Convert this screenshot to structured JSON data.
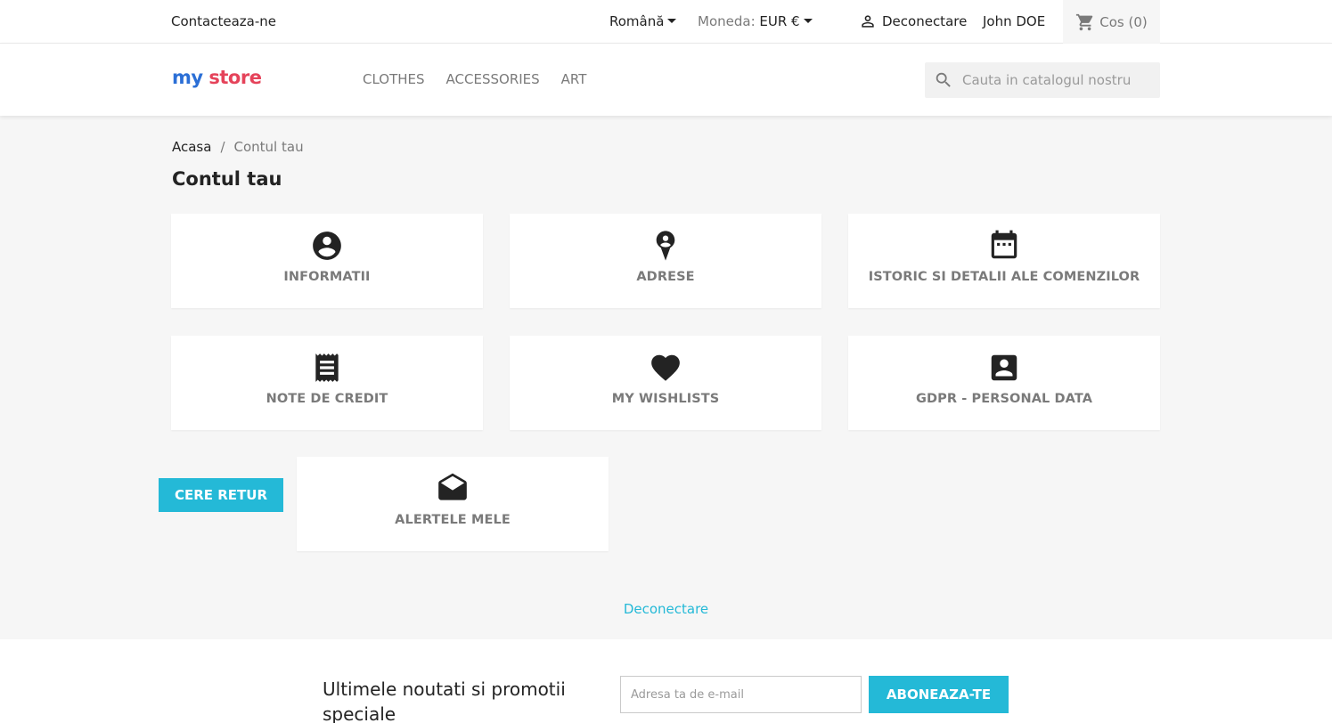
{
  "topbar": {
    "contact": "Contacteaza-ne",
    "language": "Română",
    "currency_label": "Moneda:",
    "currency_value": "EUR €",
    "logout": "Deconectare",
    "user_name": "John DOE",
    "cart": "Cos (0)"
  },
  "header": {
    "logo": {
      "part1": "my",
      "part2": "store"
    },
    "nav": [
      "CLOTHES",
      "ACCESSORIES",
      "ART"
    ],
    "search_placeholder": "Cauta in catalogul nostru"
  },
  "breadcrumb": {
    "home": "Acasa",
    "separator": "/",
    "current": "Contul tau"
  },
  "page_title": "Contul tau",
  "cards": [
    {
      "label": "INFORMATII",
      "icon": "account-circle-icon"
    },
    {
      "label": "ADRESE",
      "icon": "location-pin-icon"
    },
    {
      "label": "ISTORIC SI DETALII ALE COMENZILOR",
      "icon": "calendar-icon"
    },
    {
      "label": "NOTE DE CREDIT",
      "icon": "receipt-icon"
    },
    {
      "label": "MY WISHLISTS",
      "icon": "heart-icon"
    },
    {
      "label": "GDPR - PERSONAL DATA",
      "icon": "contact-card-icon"
    },
    {
      "label": "ALERTELE MELE",
      "icon": "open-envelope-icon"
    }
  ],
  "return_button": "CERE RETUR",
  "logout_link": "Deconectare",
  "newsletter": {
    "title": "Ultimele noutati si promotii speciale",
    "placeholder": "Adresa ta de e-mail",
    "button": "ABONEAZA-TE"
  },
  "colors": {
    "accent": "#24b9d7",
    "muted_text": "#7a7a7a",
    "background": "#f6f6f6"
  }
}
